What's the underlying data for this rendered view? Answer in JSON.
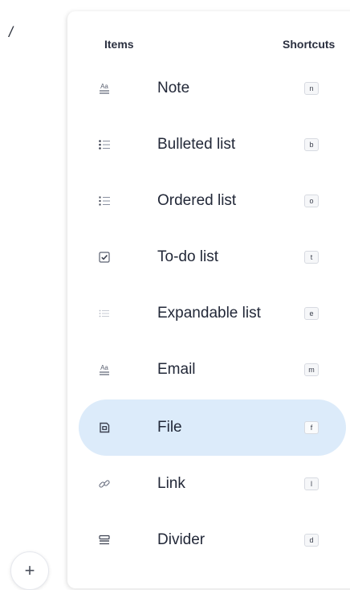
{
  "editor": {
    "slash_text": "/",
    "add_button_label": "+"
  },
  "menu": {
    "items_header": "Items",
    "shortcuts_header": "Shortcuts",
    "items": [
      {
        "label": "Note",
        "shortcut": "n",
        "icon": "text-format-icon",
        "active": false
      },
      {
        "label": "Bulleted list",
        "shortcut": "b",
        "icon": "bulleted-list-icon",
        "active": false
      },
      {
        "label": "Ordered list",
        "shortcut": "o",
        "icon": "ordered-list-icon",
        "active": false
      },
      {
        "label": "To-do list",
        "shortcut": "t",
        "icon": "checkbox-icon",
        "active": false
      },
      {
        "label": "Expandable list",
        "shortcut": "e",
        "icon": "expandable-list-icon",
        "active": false
      },
      {
        "label": "Email",
        "shortcut": "m",
        "icon": "text-format-icon",
        "active": false
      },
      {
        "label": "File",
        "shortcut": "f",
        "icon": "file-icon",
        "active": true
      },
      {
        "label": "Link",
        "shortcut": "l",
        "icon": "link-icon",
        "active": false
      },
      {
        "label": "Divider",
        "shortcut": "d",
        "icon": "divider-icon",
        "active": false
      }
    ]
  },
  "colors": {
    "active_row_bg": "#dcebfa",
    "text": "#222838",
    "icon": "#5a6070"
  }
}
